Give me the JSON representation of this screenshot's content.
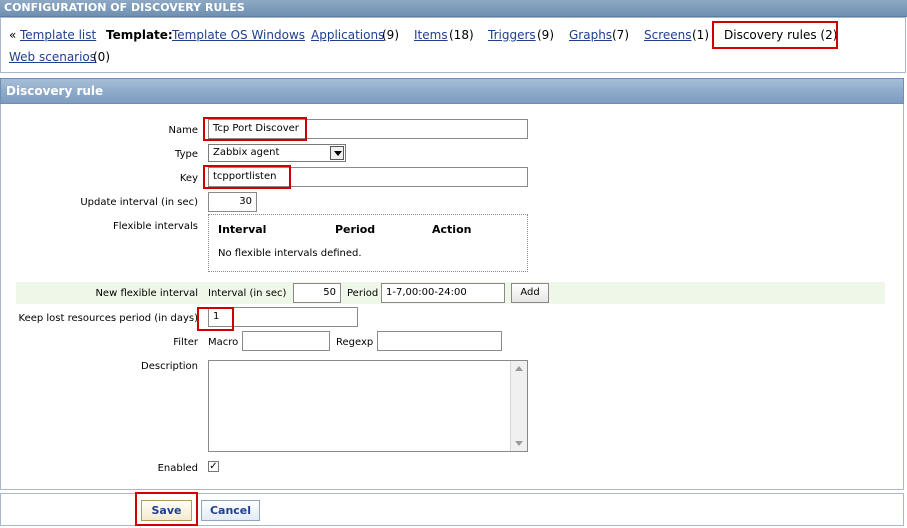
{
  "header": {
    "title": "CONFIGURATION OF DISCOVERY RULES"
  },
  "nav": {
    "prefix": "«",
    "template_list": "Template list",
    "template_label": "Template:",
    "template_name": "Template OS Windows",
    "applications": "Applications",
    "applications_count": "(9)",
    "items": "Items",
    "items_count": "(18)",
    "triggers": "Triggers",
    "triggers_count": "(9)",
    "graphs": "Graphs",
    "graphs_count": "(7)",
    "screens": "Screens",
    "screens_count": "(1)",
    "discovery_rules": "Discovery rules (2)",
    "web_scenarios": "Web scenarios",
    "web_scenarios_count": "(0)"
  },
  "section": {
    "title": "Discovery rule"
  },
  "form": {
    "name_label": "Name",
    "name_value": "Tcp Port Discover",
    "type_label": "Type",
    "type_value": "Zabbix agent",
    "key_label": "Key",
    "key_value": "tcpportlisten",
    "update_label": "Update interval (in sec)",
    "update_value": "30",
    "flex_label": "Flexible intervals",
    "flex_col_interval": "Interval",
    "flex_col_period": "Period",
    "flex_col_action": "Action",
    "flex_empty": "No flexible intervals defined.",
    "new_flex_label": "New flexible interval",
    "new_flex_interval_label": "Interval (in sec)",
    "new_flex_interval_value": "50",
    "new_flex_period_label": "Period",
    "new_flex_period_value": "1-7,00:00-24:00",
    "add_button": "Add",
    "keep_label": "Keep lost resources period (in days)",
    "keep_value": "1",
    "filter_label": "Filter",
    "macro_label": "Macro",
    "regexp_label": "Regexp",
    "description_label": "Description",
    "enabled_label": "Enabled",
    "enabled_mark": "✓"
  },
  "footer": {
    "save": "Save",
    "cancel": "Cancel"
  }
}
